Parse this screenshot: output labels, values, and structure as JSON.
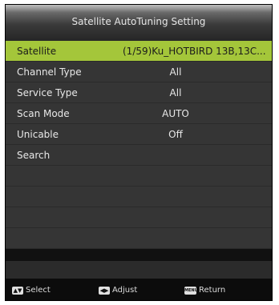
{
  "header": {
    "title": "Satellite AutoTuning Setting"
  },
  "rows": [
    {
      "label": "Satellite",
      "value": "(1/59)Ku_HOTBIRD 13B,13C..."
    },
    {
      "label": "Channel Type",
      "value": "All"
    },
    {
      "label": "Service Type",
      "value": "All"
    },
    {
      "label": "Scan Mode",
      "value": "AUTO"
    },
    {
      "label": "Unicable",
      "value": "Off"
    },
    {
      "label": "Search",
      "value": ""
    }
  ],
  "footer": {
    "select_label": "Select",
    "adjust_label": "Adjust",
    "return_label": "Return",
    "menu_key_label": "MENU",
    "icons": {
      "select": "up-down-arrows-icon",
      "adjust": "left-right-arrows-icon",
      "return": "menu-key-icon"
    }
  },
  "colors": {
    "highlight": "#a4c63a",
    "row": "#353535",
    "background": "#111111"
  }
}
